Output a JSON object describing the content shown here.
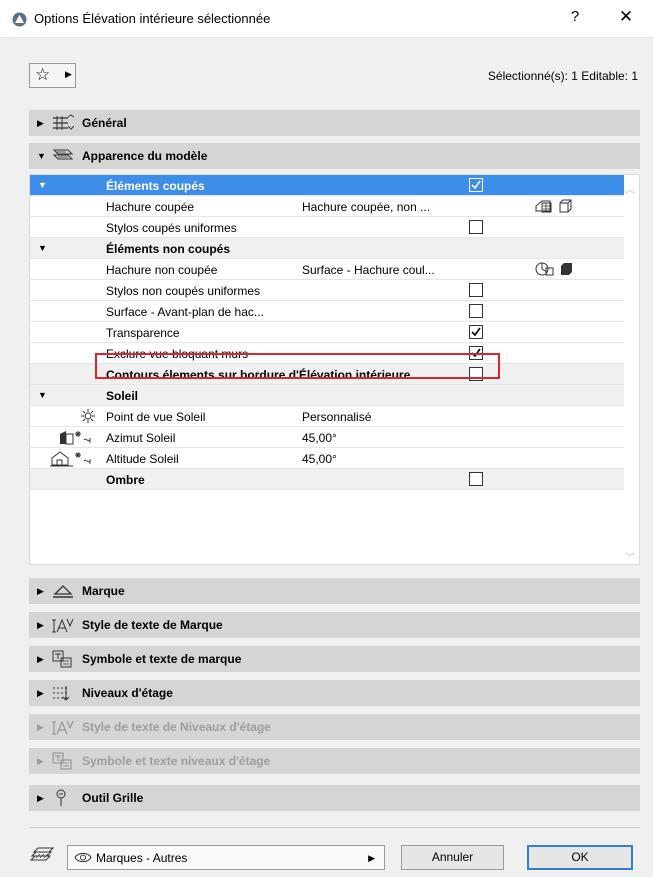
{
  "window": {
    "title": "Options Élévation intérieure sélectionnée",
    "help_label": "?",
    "close_label": "✕"
  },
  "toolbar": {
    "favorites_icon": "star-icon",
    "selection_info": "Sélectionné(s): 1 Editable: 1"
  },
  "panels_top": [
    {
      "label": "Général",
      "expanded": false
    },
    {
      "label": "Apparence du modèle",
      "expanded": true
    }
  ],
  "tree": {
    "rows": [
      {
        "label": "Éléments coupés",
        "type": "group",
        "checked": true
      },
      {
        "label": "Hachure coupée",
        "value": "Hachure coupée, non ..."
      },
      {
        "label": "Stylos coupés uniformes",
        "checked": false
      },
      {
        "label": "Éléments non coupés",
        "type": "group"
      },
      {
        "label": "Hachure non coupée",
        "value": "Surface - Hachure coul..."
      },
      {
        "label": "Stylos non coupés uniformes",
        "checked": false
      },
      {
        "label": "Surface - Avant-plan de hac...",
        "checked": false
      },
      {
        "label": "Transparence",
        "checked": true
      },
      {
        "label": "Exclure vue bloquant murs",
        "checked": true
      },
      {
        "label": "Contours élements sur bordure d'Élévation intérieure",
        "checked": false
      },
      {
        "label": "Soleil",
        "type": "group"
      },
      {
        "label": "Point de vue Soleil",
        "value": "Personnalisé"
      },
      {
        "label": "Azimut Soleil",
        "value": "45,00°"
      },
      {
        "label": "Altitude Soleil",
        "value": "45,00°"
      },
      {
        "label": "Ombre",
        "checked": false
      }
    ]
  },
  "panels_bottom": [
    {
      "label": "Marque",
      "enabled": true
    },
    {
      "label": "Style de texte de Marque",
      "enabled": true
    },
    {
      "label": "Symbole et texte de marque",
      "enabled": true
    },
    {
      "label": "Niveaux d'étage",
      "enabled": true
    },
    {
      "label": "Style de texte de Niveaux d'étage",
      "enabled": false
    },
    {
      "label": "Symbole et texte niveaux d'étage",
      "enabled": false
    },
    {
      "label": "Outil Grille",
      "enabled": true
    }
  ],
  "footer": {
    "layer_value": "Marques - Autres",
    "cancel_label": "Annuler",
    "ok_label": "OK"
  },
  "colors": {
    "selection": "#3c8ee9",
    "highlight_border": "#e0242b",
    "panel_header": "#d5d5d5",
    "ok_border": "#2f7ed8"
  }
}
